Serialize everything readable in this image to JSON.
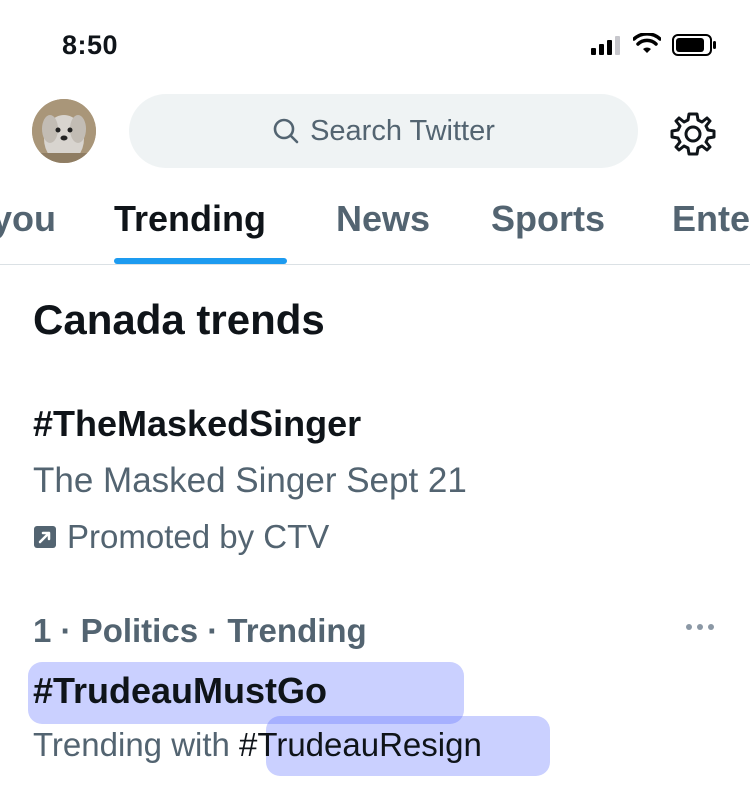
{
  "status_bar": {
    "time": "8:50"
  },
  "header": {
    "search_placeholder": "Search Twitter"
  },
  "tabs": [
    {
      "label": "you"
    },
    {
      "label": "Trending"
    },
    {
      "label": "News"
    },
    {
      "label": "Sports"
    },
    {
      "label": "Ente"
    }
  ],
  "section": {
    "title": "Canada trends"
  },
  "promoted": {
    "hashtag": "#TheMaskedSinger",
    "description": "The Masked Singer Sept 21",
    "promoted_by": "Promoted by CTV"
  },
  "trend": {
    "meta": "1 · Politics · Trending",
    "hashtag": "#TrudeauMustGo",
    "with_prefix": "Trending with",
    "with_tag": "#TrudeauResign"
  },
  "colors": {
    "accent": "#1d9bf0",
    "muted": "#536471",
    "highlight": "#5a6eff"
  }
}
